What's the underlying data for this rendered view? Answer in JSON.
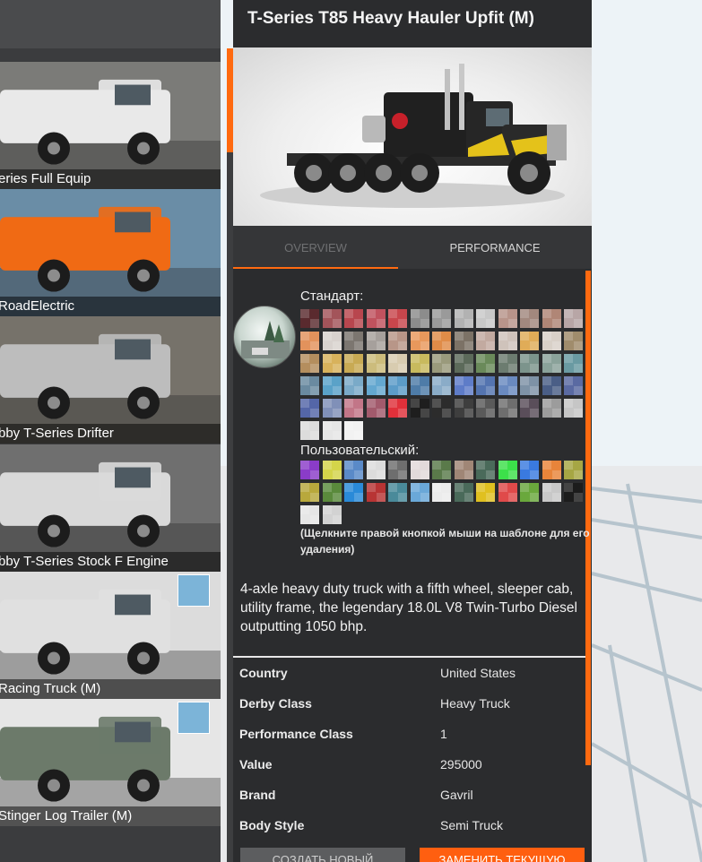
{
  "vehicle_list": [
    {
      "label": "eries Full Equip",
      "bg": "#7b7b78",
      "truck": "#e9e9e9",
      "badge": false
    },
    {
      "label": "RoadElectric",
      "bg": "#6a8da6",
      "truck": "#f06a14",
      "badge": false
    },
    {
      "label": "bby T-Series Drifter",
      "bg": "#76726a",
      "truck": "#bdbdbd",
      "badge": false
    },
    {
      "label": "bby T-Series Stock F Engine",
      "bg": "#6f6f6f",
      "truck": "#d9d9d9",
      "badge": false
    },
    {
      "label": "Racing Truck (M)",
      "bg": "#dcdcdc",
      "truck": "#e0e0e0",
      "badge": true
    },
    {
      "label": "Stinger Log Trailer (M)",
      "bg": "#e6e6e6",
      "truck": "#6c7a6a",
      "badge": true
    }
  ],
  "panel": {
    "title": "T-Series T85 Heavy Hauler Upfit (M)",
    "tabs": {
      "overview": "OVERVIEW",
      "performance": "PERFORMANCE"
    },
    "standard_label": "Стандарт:",
    "custom_label": "Пользовательский:",
    "hint": "(Щелкните правой кнопкой мыши на шаблоне для его удаления)",
    "description": "4-axle heavy duty truck with a fifth wheel, sleeper cab, utility frame, the legendary 18.0L V8 Twin-Turbo Diesel outputting 1050 bhp.",
    "properties": [
      {
        "key": "Country",
        "value": "United States"
      },
      {
        "key": "Derby Class",
        "value": "Heavy Truck"
      },
      {
        "key": "Performance Class",
        "value": "1"
      },
      {
        "key": "Value",
        "value": "295000"
      },
      {
        "key": "Brand",
        "value": "Gavril"
      },
      {
        "key": "Body Style",
        "value": "Semi Truck"
      }
    ],
    "buttons": {
      "create": "СОЗДАТЬ НОВЫЙ",
      "replace": "ЗАМЕНИТЬ ТЕКУЩУЮ"
    }
  },
  "standard_colors": [
    "#5a2a2e",
    "#a3545a",
    "#b8464e",
    "#c0525e",
    "#c8464c",
    "#8c8c8c",
    "#9a9a9a",
    "#b2b2b2",
    "#c8c8c8",
    "#b8948a",
    "#a2887e",
    "#b08676",
    "#b8a6a6",
    "#e2925c",
    "#d8d2ce",
    "#7c7670",
    "#a6a09c",
    "#b89688",
    "#e8985c",
    "#e08c48",
    "#7c7266",
    "#c2aaa0",
    "#cfc3bb",
    "#e0ac58",
    "#d8d0c8",
    "#a08c6c",
    "#b48e5e",
    "#d8b25c",
    "#c8aa54",
    "#ccbc7c",
    "#d8ccb0",
    "#c8ba5e",
    "#9a9a7c",
    "#5c6a5a",
    "#6a8a5a",
    "#6c7c70",
    "#7c948c",
    "#8aa29a",
    "#6a9aa2",
    "#6a8aa0",
    "#5aa2c8",
    "#7aaac8",
    "#64a8d0",
    "#5c9cc8",
    "#4e7ca8",
    "#8aacc8",
    "#5e7cc8",
    "#5474b0",
    "#6a8ac0",
    "#7e92a6",
    "#4a5e86",
    "#5a6aa2",
    "#5466a8",
    "#8090b8",
    "#c27688",
    "#a25a6c",
    "#e0303a",
    "#1e1e1e",
    "#2c2c2c",
    "#3e3e3e",
    "#5a5a5a",
    "#6e6e6e",
    "#5a4e5a",
    "#9c9c9c",
    "#c6c6c6",
    "#dcdcdc",
    "#e6e6e6",
    "#f2f2f2"
  ],
  "custom_colors": [
    "#8a3cc8",
    "#d4d44a",
    "#5a8ac8",
    "#dcdcdc",
    "#6e6e6e",
    "#e2dada",
    "#5a7a4a",
    "#a08676",
    "#4a6a5a",
    "#3ce04a",
    "#3a7ae0",
    "#e8843a",
    "#a6a644",
    "#b8a83c",
    "#5a8a3c",
    "#2a8ad8",
    "#b83434",
    "#4a8a9a",
    "#6aa8d8",
    "#ececec",
    "#4a6a5a",
    "#e0c020",
    "#e04a4a",
    "#6aa83c",
    "#c8c8c8",
    "#1c1c1c",
    "#e6e6e6",
    "#d2d2d2"
  ],
  "colors": {
    "accent": "#ff6a10",
    "panel_bg": "#2b2c2e",
    "tab_bg": "#353638"
  }
}
